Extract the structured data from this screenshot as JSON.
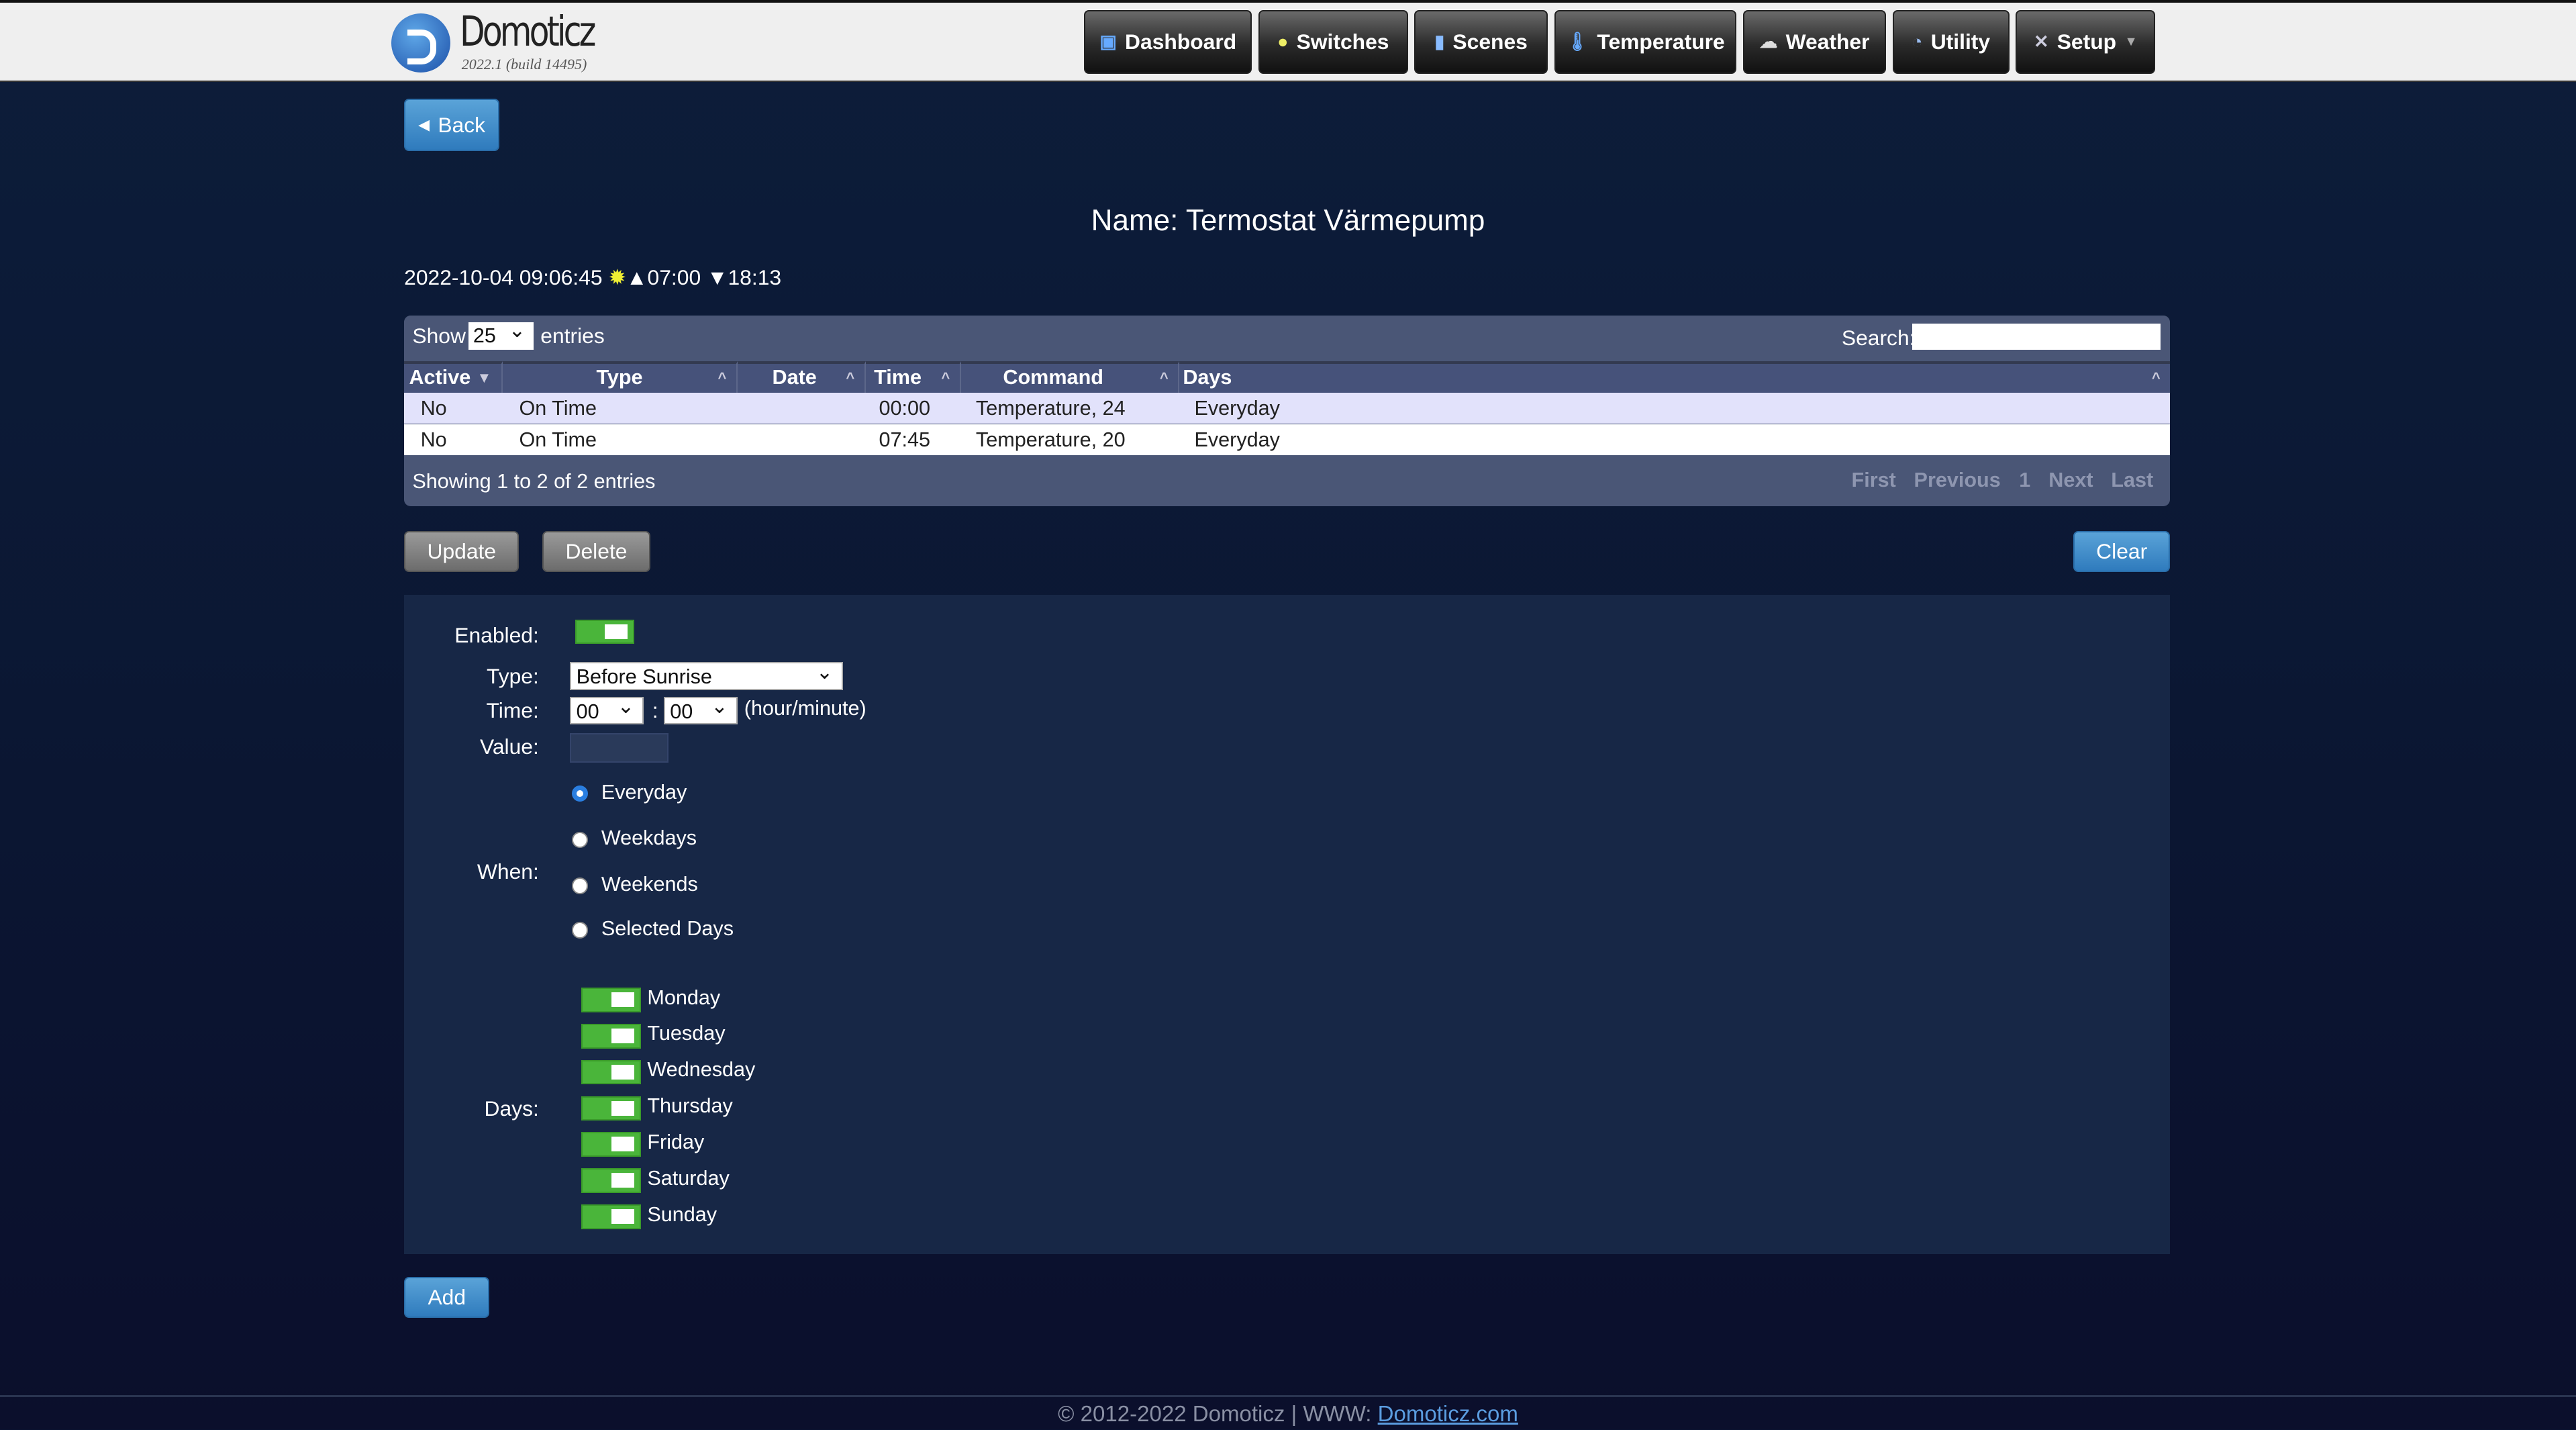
{
  "app": {
    "name": "Domoticz",
    "version": "2022.1 (build 14495)"
  },
  "nav": [
    {
      "label": "Dashboard",
      "icon": "dashboard-icon"
    },
    {
      "label": "Switches",
      "icon": "lightbulb-icon"
    },
    {
      "label": "Scenes",
      "icon": "clapperboard-icon"
    },
    {
      "label": "Temperature",
      "icon": "thermometer-icon"
    },
    {
      "label": "Weather",
      "icon": "cloud-icon"
    },
    {
      "label": "Utility",
      "icon": "gauge-icon"
    },
    {
      "label": "Setup",
      "icon": "tools-icon"
    }
  ],
  "back_label": "Back",
  "page_title": "Name: Termostat Värmepump",
  "datetime": {
    "now": "2022-10-04 09:06:45",
    "sunrise": "07:00",
    "sunset": "18:13"
  },
  "table": {
    "show_label": "Show",
    "entries_value": "25",
    "entries_label": "entries",
    "search_label": "Search:",
    "search_value": "",
    "columns": [
      "Active",
      "Type",
      "Date",
      "Time",
      "Command",
      "Days"
    ],
    "rows": [
      [
        "No",
        "On Time",
        "",
        "00:00",
        "Temperature, 24",
        "Everyday"
      ],
      [
        "No",
        "On Time",
        "",
        "07:45",
        "Temperature, 20",
        "Everyday"
      ]
    ],
    "info": "Showing 1 to 2 of 2 entries",
    "pagination": [
      "First",
      "Previous",
      "1",
      "Next",
      "Last"
    ]
  },
  "actions": {
    "update": "Update",
    "delete": "Delete",
    "clear": "Clear",
    "add": "Add"
  },
  "form": {
    "enabled_label": "Enabled:",
    "enabled": true,
    "type_label": "Type:",
    "type_value": "Before Sunrise",
    "time_label": "Time:",
    "hour": "00",
    "minute": "00",
    "time_sep": ":",
    "time_unit": "(hour/minute)",
    "value_label": "Value:",
    "value": "",
    "when_label": "When:",
    "when_options": [
      "Everyday",
      "Weekdays",
      "Weekends",
      "Selected Days"
    ],
    "when_selected": "Everyday",
    "days_label": "Days:",
    "days": [
      "Monday",
      "Tuesday",
      "Wednesday",
      "Thursday",
      "Friday",
      "Saturday",
      "Sunday"
    ]
  },
  "footer": {
    "text": "© 2012-2022 Domoticz | WWW: ",
    "link": "Domoticz.com"
  }
}
